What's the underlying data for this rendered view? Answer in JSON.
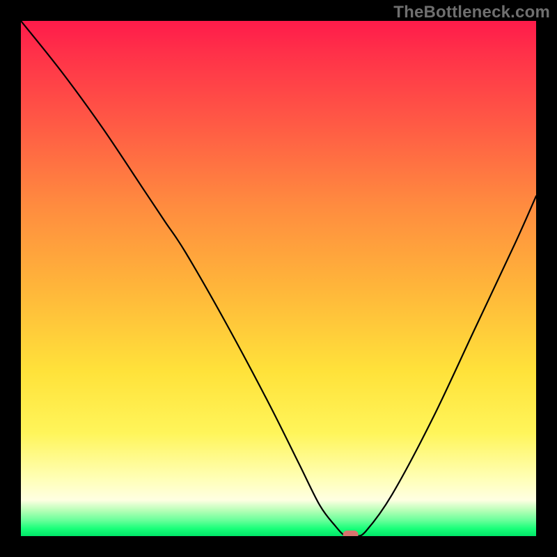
{
  "watermark": "TheBottleneck.com",
  "chart_data": {
    "type": "line",
    "title": "",
    "xlabel": "",
    "ylabel": "",
    "xlim": [
      0,
      100
    ],
    "ylim": [
      0,
      100
    ],
    "grid": false,
    "legend": false,
    "background_gradient": {
      "top": "#ff1b4a",
      "upper_mid": "#ff8c3f",
      "mid": "#ffe23a",
      "lower_mid": "#ffffb8",
      "bottom_band": "#00e668"
    },
    "series": [
      {
        "name": "bottleneck-curve",
        "x": [
          0,
          8,
          16,
          24,
          28,
          32,
          40,
          48,
          54,
          58,
          61,
          63,
          65,
          67,
          72,
          80,
          88,
          96,
          100
        ],
        "y": [
          100,
          90,
          79,
          67,
          61,
          55,
          41,
          26,
          14,
          6,
          2,
          0,
          0,
          1,
          8,
          23,
          40,
          57,
          66
        ]
      }
    ],
    "marker": {
      "name": "optimal-point",
      "x": 64,
      "y": 0,
      "color": "#d9736e"
    }
  }
}
